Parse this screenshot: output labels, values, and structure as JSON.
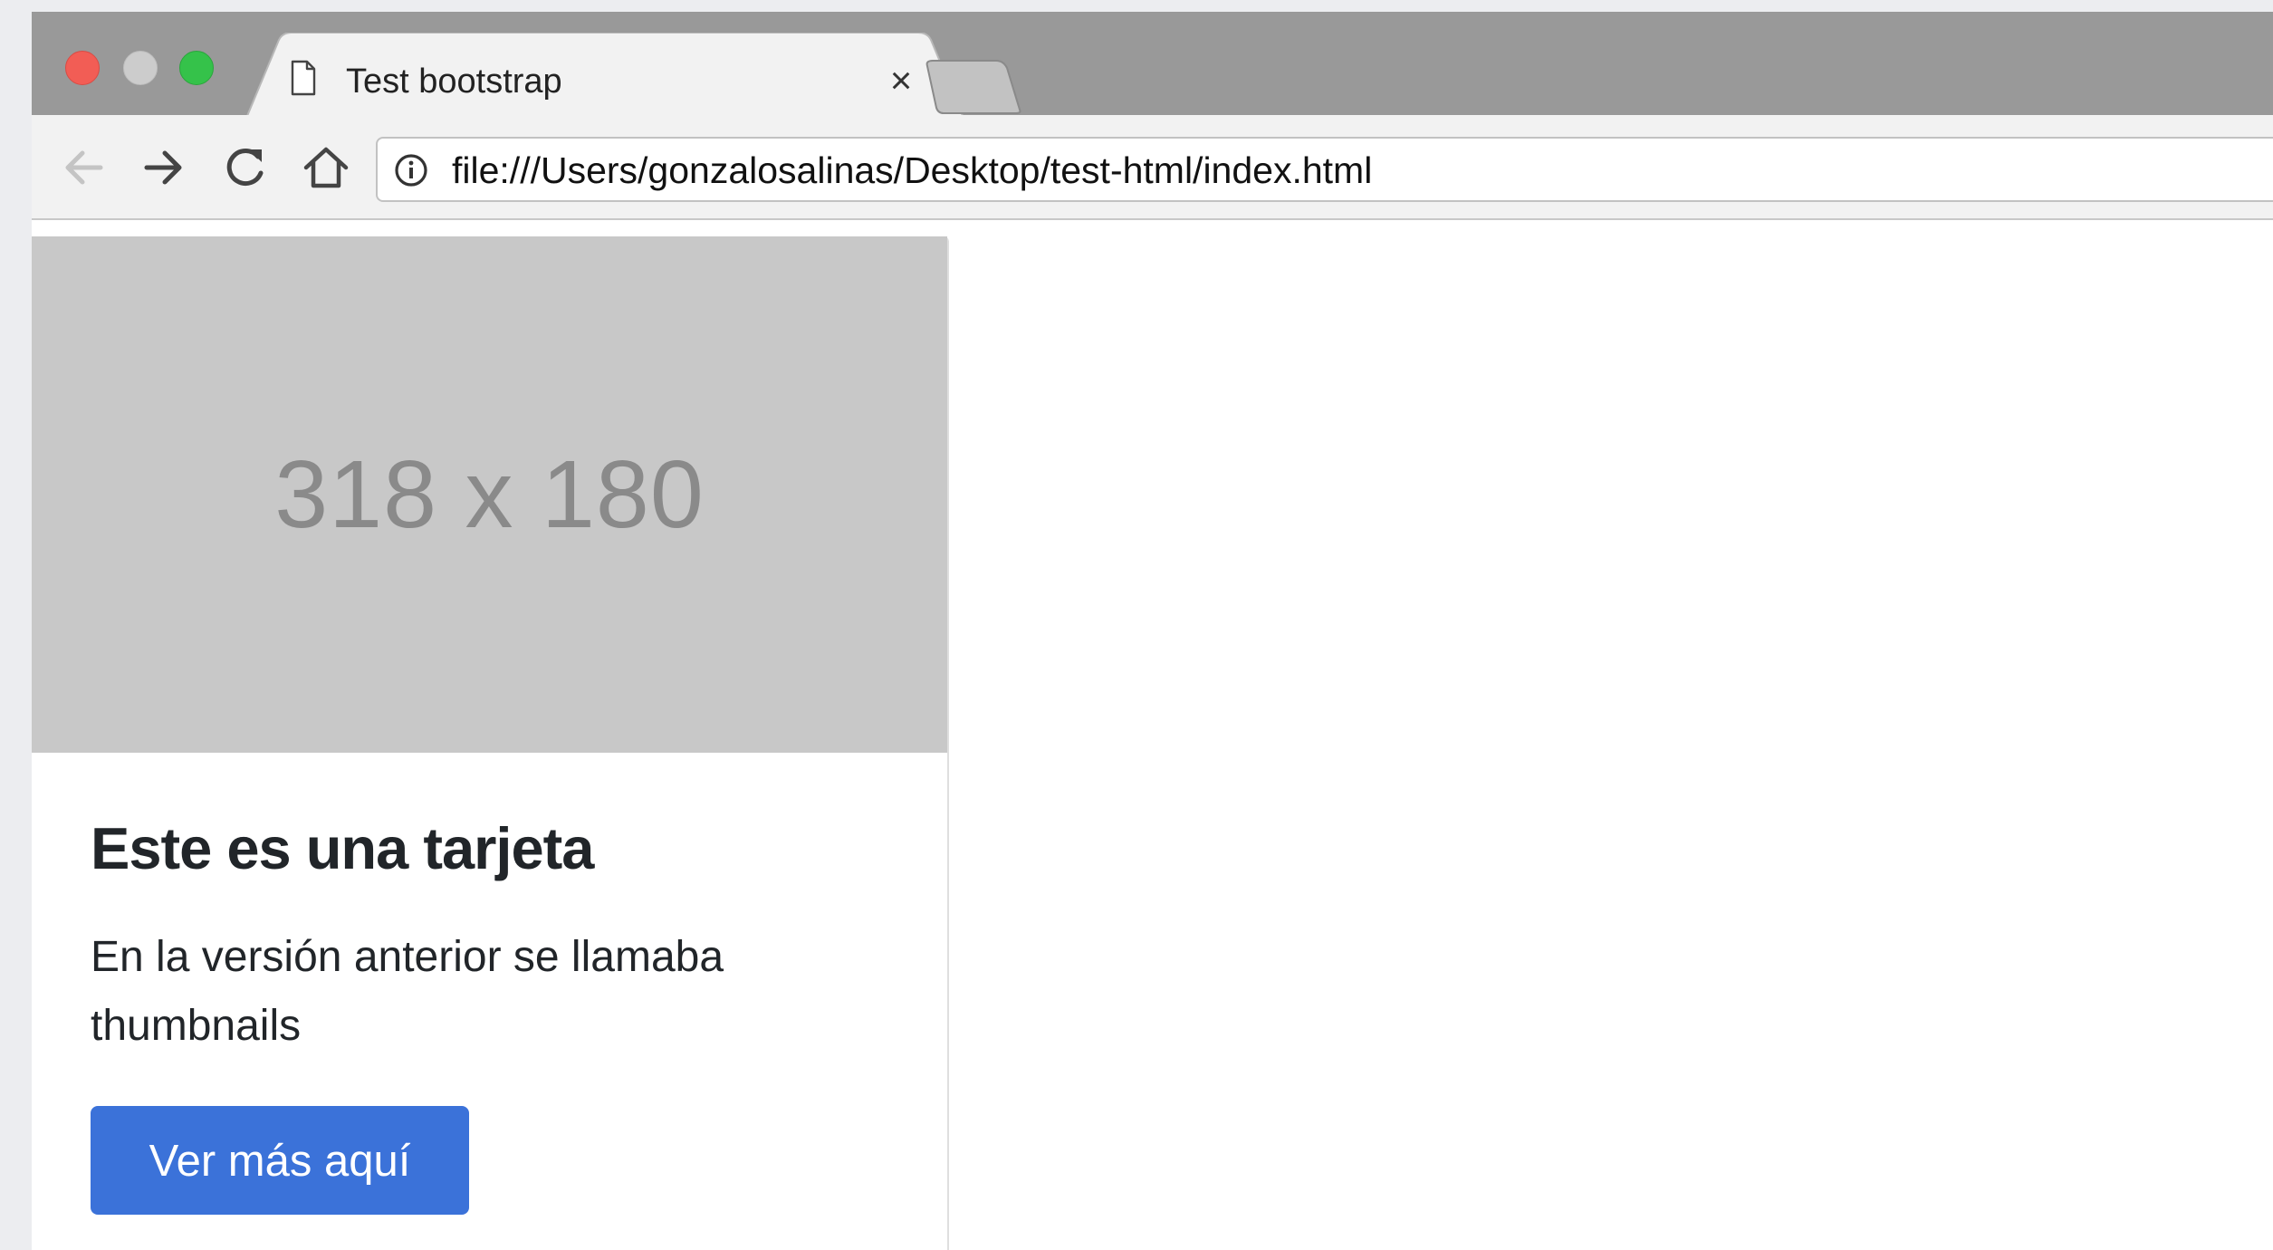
{
  "browser": {
    "tab": {
      "title": "Test bootstrap",
      "close_glyph": "×",
      "icon": "page-icon"
    },
    "new_tab_icon": "new-tab-icon",
    "toolbar": {
      "back_icon": "back-arrow-icon",
      "forward_icon": "forward-arrow-icon",
      "reload_icon": "reload-icon",
      "home_icon": "home-icon"
    },
    "address_bar": {
      "info_icon": "info-icon",
      "url": "file:///Users/gonzalosalinas/Desktop/test-html/index.html"
    },
    "window_controls": {
      "close_color": "#f25d55",
      "minimize_color": "#cccccc",
      "maximize_color": "#35c24a"
    }
  },
  "page": {
    "card": {
      "image_placeholder": "318 x 180",
      "title": "Este es una tarjeta",
      "text": "En la versión anterior se llamaba thumbnails",
      "button_label": "Ver más aquí",
      "button_color": "#3b72d9"
    }
  }
}
